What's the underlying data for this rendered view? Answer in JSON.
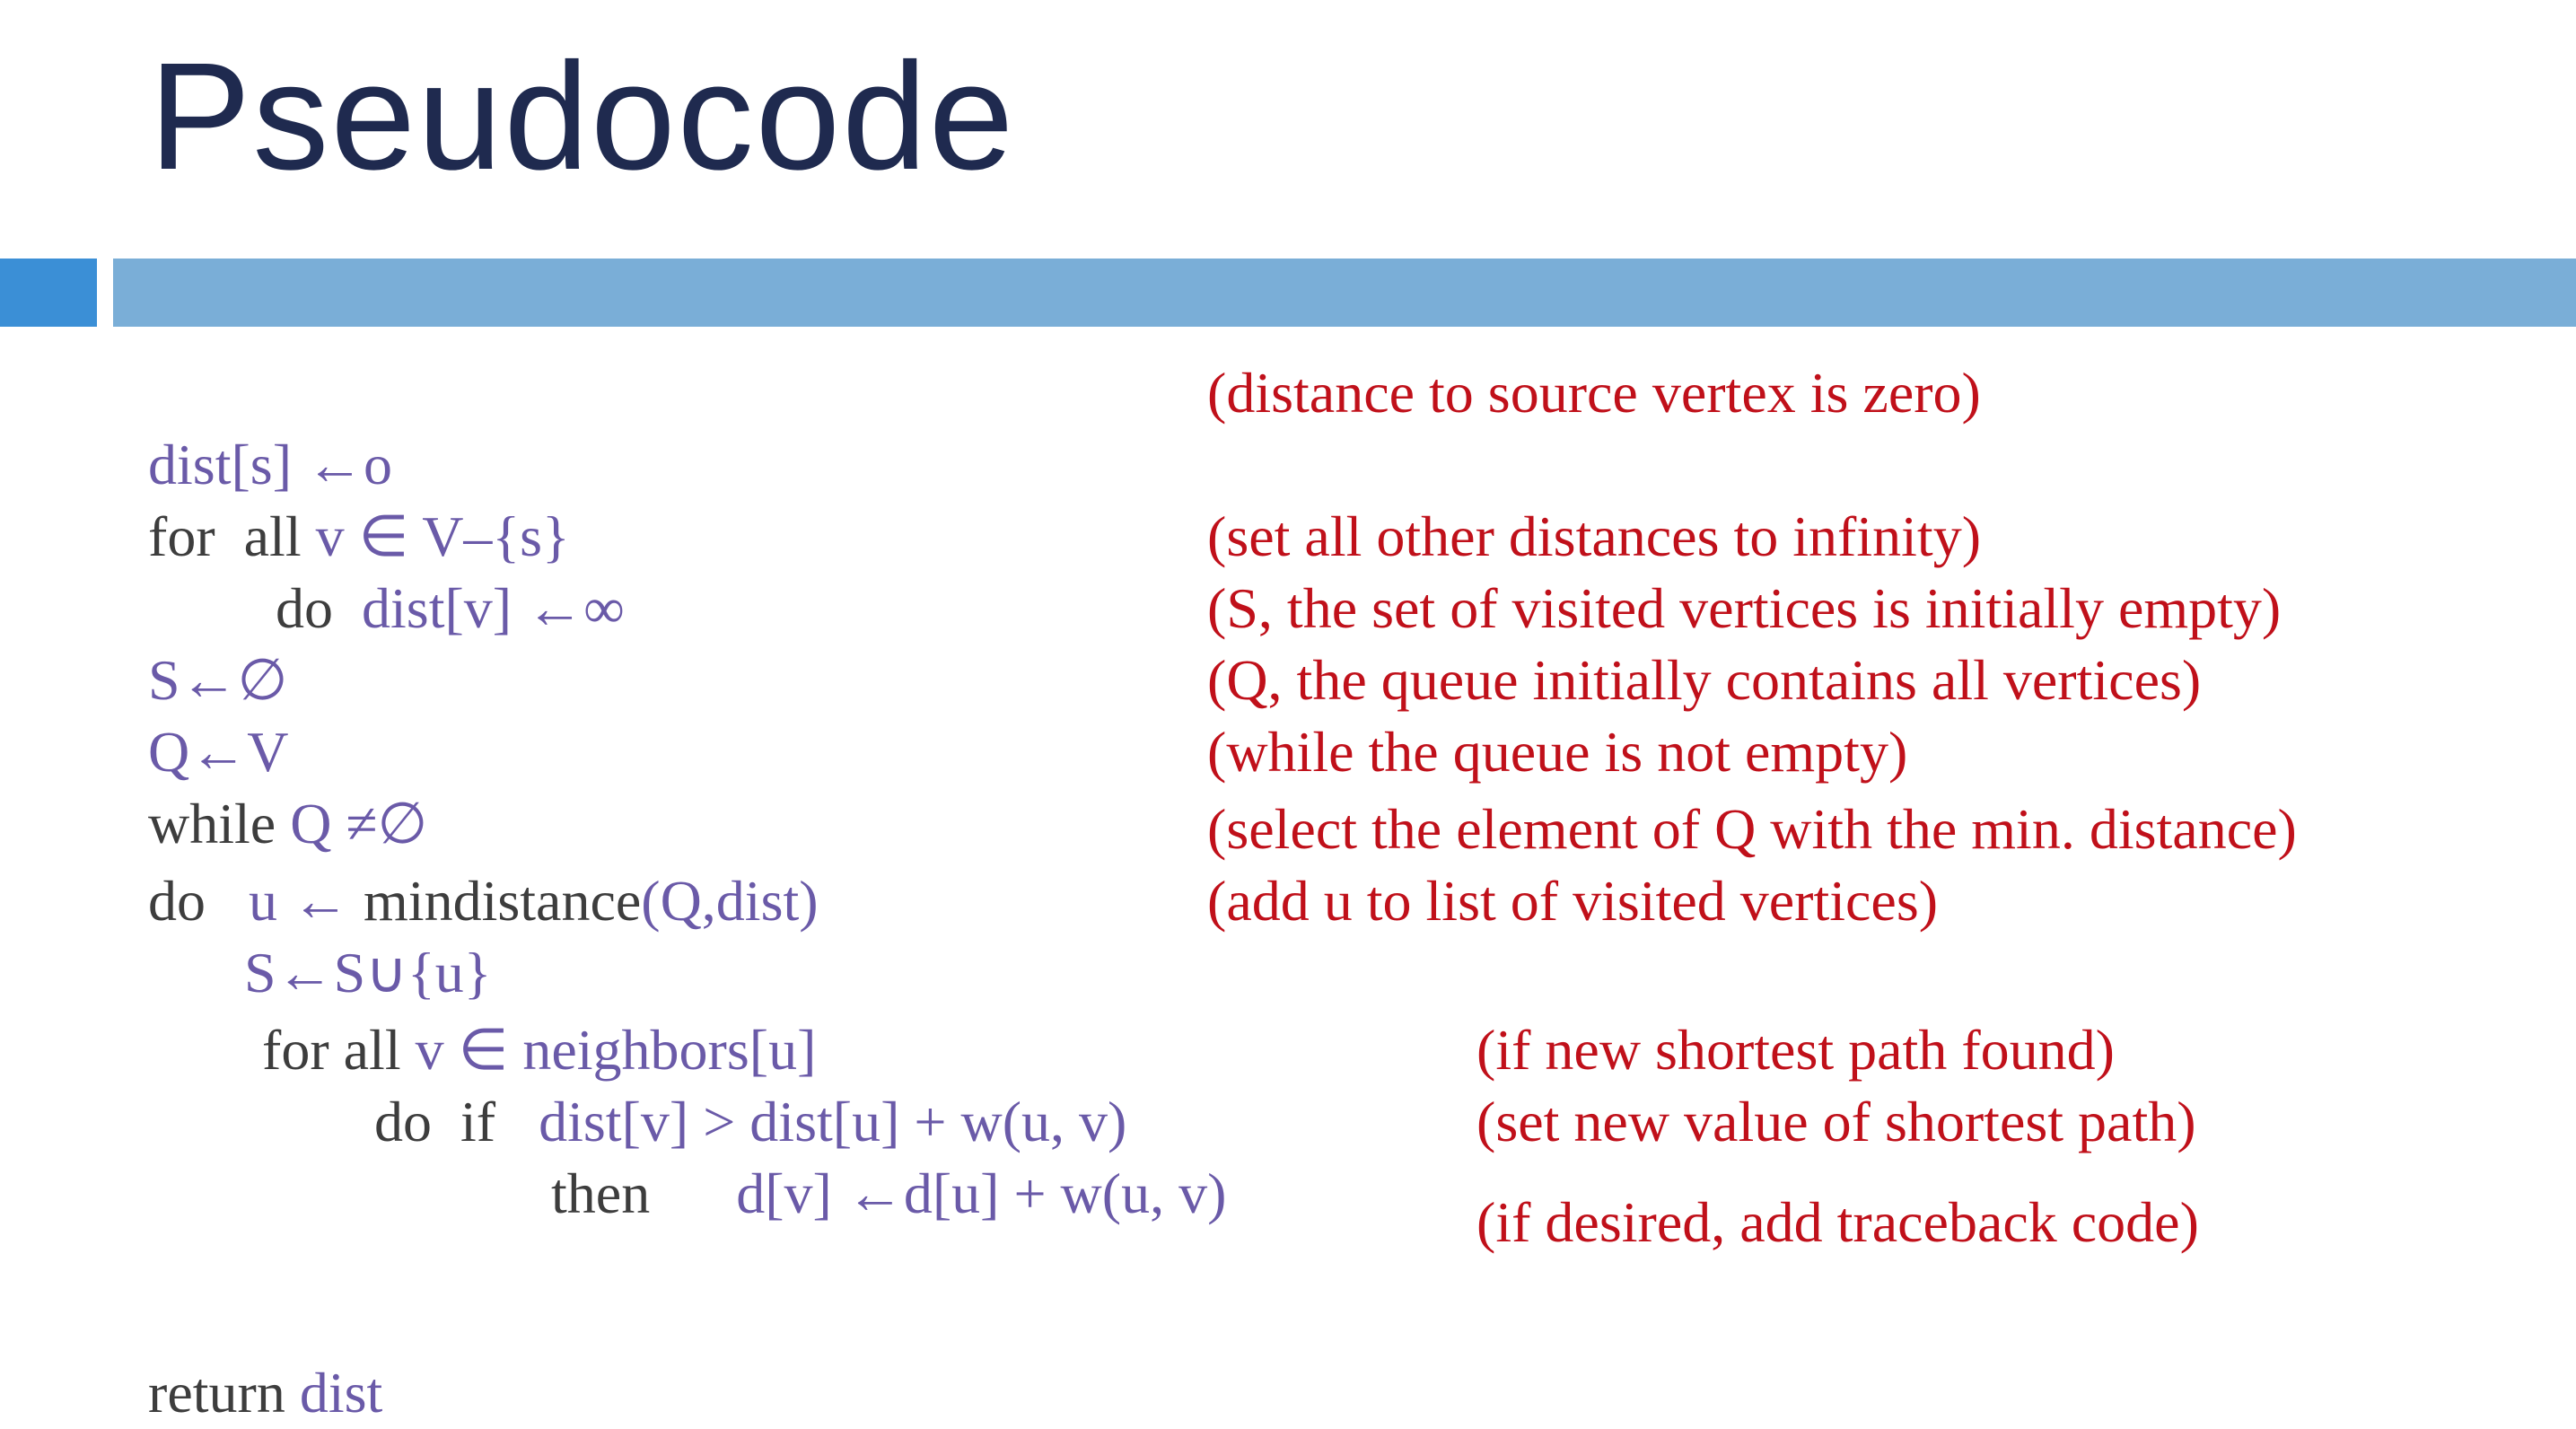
{
  "title": "Pseudocode",
  "colors": {
    "title": "#1f2a4f",
    "keyword": "#3d3d3d",
    "variable": "#6a5aa8",
    "comment": "#c0101a",
    "accent_bar": "#3b8fd6",
    "header_bar": "#7aaed7"
  },
  "code": {
    "l1": {
      "a": "dist[s] ←o"
    },
    "l2": {
      "a": "for  all ",
      "b": "v ∈ V–{s}"
    },
    "l3": {
      "a": "do  ",
      "b": "dist[v] ←∞"
    },
    "l4": {
      "a": "S←∅"
    },
    "l5": {
      "a": "Q←V"
    },
    "l6": {
      "a": "while ",
      "b": "Q ≠∅"
    },
    "l7": {
      "a": "do   ",
      "b": "u ← ",
      "c": "mindistance",
      "d": "(Q,dist)"
    },
    "l8": {
      "a": "S←S∪{u}"
    },
    "l9": {
      "a": "for all ",
      "b": "v ∈ neighbors[u]"
    },
    "l10": {
      "a": "do  if   ",
      "b": "dist[v] > dist[u] + w(u, v)"
    },
    "l11": {
      "a": "then      ",
      "b": "d[v] ←d[u] + w(u, v)"
    },
    "l12": {
      "a": "return ",
      "b": "dist"
    }
  },
  "comments": [
    "(distance to source vertex is zero)",
    "(set all other distances to infinity)",
    "(S, the set of visited vertices is initially empty)",
    "(Q, the queue initially contains all vertices)",
    "(while the queue is not empty)",
    "(select the element of Q with the min. distance)",
    "(add u to list of visited vertices)",
    "(if new shortest path found)",
    "(set new value of shortest path)",
    "(if desired, add traceback code)"
  ]
}
